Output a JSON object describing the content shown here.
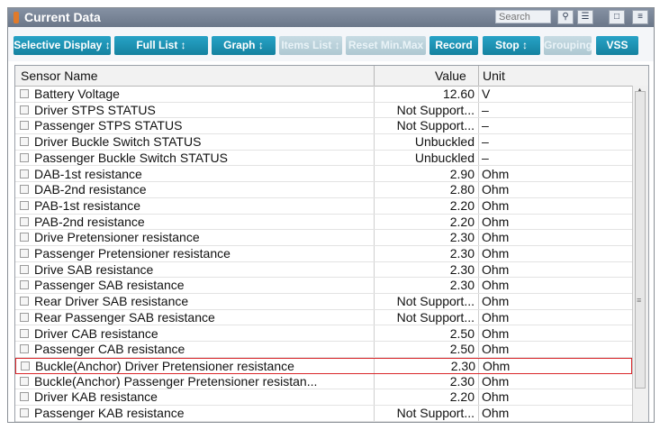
{
  "window": {
    "title": "Current Data"
  },
  "search": {
    "placeholder": "Search"
  },
  "title_icons": [
    "zoom-icon",
    "list-icon",
    "save-icon",
    "menu-icon"
  ],
  "toolbar": {
    "buttons": [
      {
        "label": "Selective Display ↕",
        "enabled": true
      },
      {
        "label": "Full List ↕",
        "enabled": true
      },
      {
        "label": "Graph ↕",
        "enabled": true
      },
      {
        "label": "Items List ↕",
        "enabled": false
      },
      {
        "label": "Reset Min.Max",
        "enabled": false
      },
      {
        "label": "Record",
        "enabled": true
      },
      {
        "label": "Stop ↕",
        "enabled": true
      },
      {
        "label": "Grouping",
        "enabled": false
      },
      {
        "label": "VSS",
        "enabled": true
      }
    ]
  },
  "table": {
    "headers": {
      "name": "Sensor Name",
      "value": "Value",
      "unit": "Unit"
    },
    "selected_index": 17,
    "rows": [
      {
        "name": "Battery Voltage",
        "value": "12.60",
        "unit": "V"
      },
      {
        "name": "Driver STPS STATUS",
        "value": "Not Support...",
        "unit": "–"
      },
      {
        "name": "Passenger STPS STATUS",
        "value": "Not Support...",
        "unit": "–"
      },
      {
        "name": "Driver Buckle Switch STATUS",
        "value": "Unbuckled",
        "unit": "–"
      },
      {
        "name": "Passenger Buckle Switch STATUS",
        "value": "Unbuckled",
        "unit": "–"
      },
      {
        "name": "DAB-1st resistance",
        "value": "2.90",
        "unit": "Ohm"
      },
      {
        "name": "DAB-2nd resistance",
        "value": "2.80",
        "unit": "Ohm"
      },
      {
        "name": "PAB-1st resistance",
        "value": "2.20",
        "unit": "Ohm"
      },
      {
        "name": "PAB-2nd resistance",
        "value": "2.20",
        "unit": "Ohm"
      },
      {
        "name": "Drive Pretensioner resistance",
        "value": "2.30",
        "unit": "Ohm"
      },
      {
        "name": "Passenger Pretensioner resistance",
        "value": "2.30",
        "unit": "Ohm"
      },
      {
        "name": "Drive SAB resistance",
        "value": "2.30",
        "unit": "Ohm"
      },
      {
        "name": "Passenger SAB resistance",
        "value": "2.30",
        "unit": "Ohm"
      },
      {
        "name": "Rear Driver SAB resistance",
        "value": "Not Support...",
        "unit": "Ohm"
      },
      {
        "name": "Rear Passenger SAB resistance",
        "value": "Not Support...",
        "unit": "Ohm"
      },
      {
        "name": "Driver CAB resistance",
        "value": "2.50",
        "unit": "Ohm"
      },
      {
        "name": "Passenger CAB resistance",
        "value": "2.50",
        "unit": "Ohm"
      },
      {
        "name": "Buckle(Anchor) Driver Pretensioner resistance",
        "value": "2.30",
        "unit": "Ohm"
      },
      {
        "name": "Buckle(Anchor) Passenger Pretensioner resistan...",
        "value": "2.30",
        "unit": "Ohm"
      },
      {
        "name": "Driver KAB resistance",
        "value": "2.20",
        "unit": "Ohm"
      },
      {
        "name": "Passenger KAB resistance",
        "value": "Not Support...",
        "unit": "Ohm"
      }
    ]
  },
  "colors": {
    "titlebar": "#6b7789",
    "button": "#15829f",
    "selection": "#d9262a"
  }
}
